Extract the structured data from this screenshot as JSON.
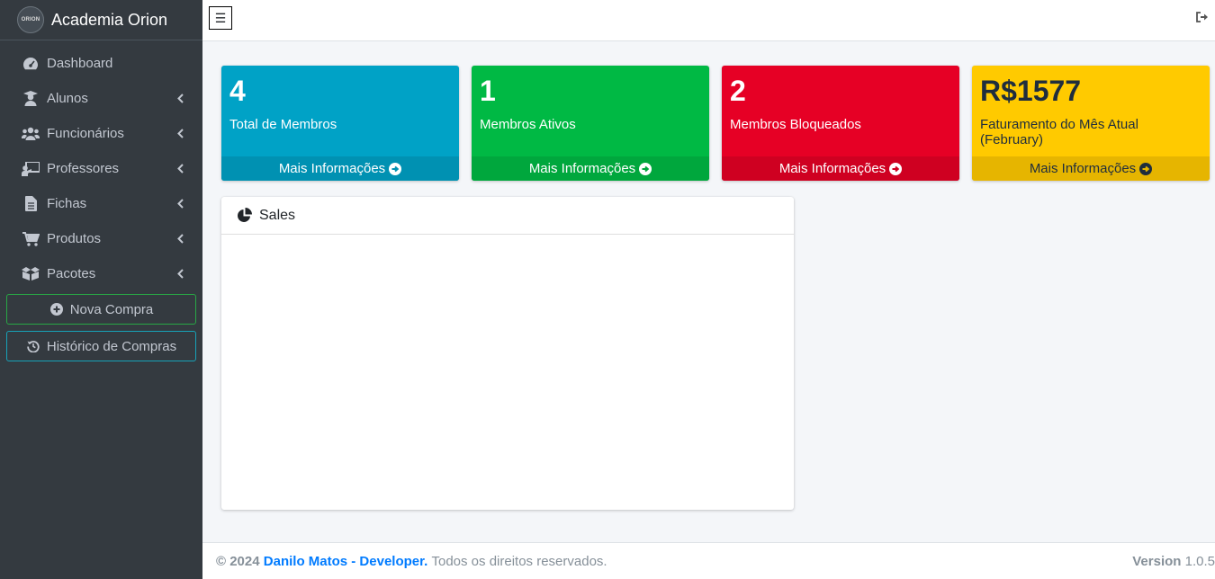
{
  "brand": {
    "logo_text": "ORION",
    "name": "Academia Orion"
  },
  "sidebar": {
    "items": [
      {
        "label": "Dashboard",
        "icon": "tachometer-icon",
        "has_children": false
      },
      {
        "label": "Alunos",
        "icon": "user-graduate-icon",
        "has_children": true
      },
      {
        "label": "Funcionários",
        "icon": "users-icon",
        "has_children": true
      },
      {
        "label": "Professores",
        "icon": "chalkboard-teacher-icon",
        "has_children": true
      },
      {
        "label": "Fichas",
        "icon": "file-alt-icon",
        "has_children": true
      },
      {
        "label": "Produtos",
        "icon": "shopping-cart-icon",
        "has_children": true
      },
      {
        "label": "Pacotes",
        "icon": "boxes-icon",
        "has_children": true
      }
    ],
    "nova_compra": "Nova Compra",
    "historico": "Histórico de Compras"
  },
  "topbar": {
    "menu_icon": "☰"
  },
  "stats": [
    {
      "value": "4",
      "label": "Total de Membros",
      "more": "Mais Informações",
      "color": "#00a2c6"
    },
    {
      "value": "1",
      "label": "Membros Ativos",
      "more": "Mais Informações",
      "color": "#00b944"
    },
    {
      "value": "2",
      "label": "Membros Bloqueados",
      "more": "Mais Informações",
      "color": "#e60025"
    },
    {
      "value": "R$1577",
      "label": "Faturamento do Mês Atual (February)",
      "more": "Mais Informações",
      "color": "#ffca00"
    }
  ],
  "sales_card": {
    "title": "Sales"
  },
  "footer": {
    "copyright": "© 2024",
    "author": "Danilo Matos - Developer.",
    "rights": "Todos os direitos reservados.",
    "version_label": "Version",
    "version_value": "1.0.5"
  }
}
